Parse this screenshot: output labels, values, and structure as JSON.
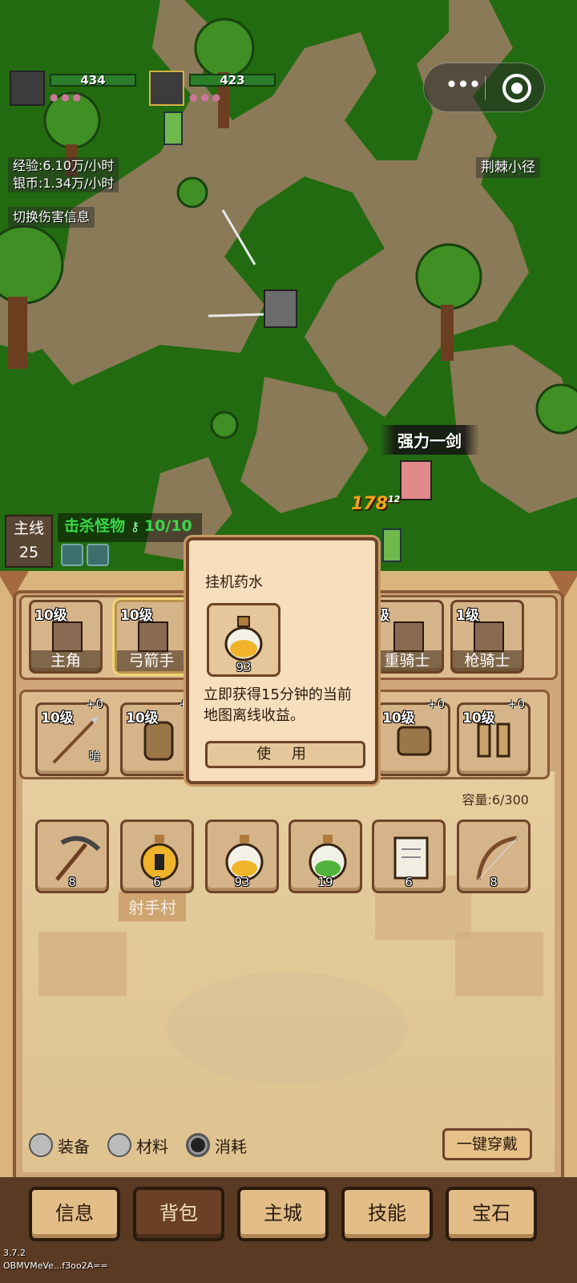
{
  "hud": {
    "player1_hp": "434",
    "player2_hp": "423",
    "exp_rate": "经验:6.10万/小时",
    "silver_rate": "银币:1.34万/小时",
    "toggle_damage": "切换伤害信息",
    "map_name": "荆棘小径",
    "skill_name": "强力一剑",
    "damage_value": "178",
    "damage_sub": "12"
  },
  "capsule": {
    "more_label": "•••"
  },
  "quest": {
    "main_label": "主线",
    "main_number": "25",
    "task_text": "击杀怪物",
    "task_progress": "10/10"
  },
  "heroes": [
    {
      "level": "10级",
      "name": "主角"
    },
    {
      "level": "10级",
      "name": "弓箭手"
    },
    {
      "level": "级",
      "name": "重骑士"
    },
    {
      "level": "1级",
      "name": "枪骑士"
    }
  ],
  "equipment": [
    {
      "level": "10级",
      "plus": "+0",
      "tag": "暗",
      "icon": "spear-icon"
    },
    {
      "level": "10级",
      "plus": "+",
      "tag": "",
      "icon": "helmet-icon"
    },
    {
      "level": "10级",
      "plus": "+0",
      "tag": "",
      "icon": "gloves-icon"
    },
    {
      "level": "10级",
      "plus": "+0",
      "tag": "",
      "icon": "boots-icon"
    }
  ],
  "capacity": "容量:6/300",
  "inventory": [
    {
      "count": "8",
      "icon": "pickaxe-icon"
    },
    {
      "count": "6",
      "icon": "potion-dark-icon"
    },
    {
      "count": "93",
      "icon": "potion-gold-icon"
    },
    {
      "count": "19",
      "icon": "potion-green-icon"
    },
    {
      "count": "6",
      "icon": "scroll-icon"
    },
    {
      "count": "8",
      "icon": "bow-icon"
    }
  ],
  "village_sign": "射手村",
  "filters": {
    "equip": "装备",
    "material": "材料",
    "consume": "消耗",
    "active": "consume"
  },
  "wear_all_label": "一键穿戴",
  "popup": {
    "title": "挂机药水",
    "count": "93",
    "desc": "立即获得15分钟的当前地图离线收益。",
    "use_label": "使 用"
  },
  "nav": [
    {
      "label": "信息"
    },
    {
      "label": "背包"
    },
    {
      "label": "主城"
    },
    {
      "label": "技能"
    },
    {
      "label": "宝石"
    }
  ],
  "version": {
    "line1": "3.7.2",
    "line2": "OBMVMeVe...f3oo2A=="
  },
  "colors": {
    "grass": "#236b10",
    "path": "#8a7a57",
    "panel": "#d9b47d",
    "nav_bg": "#5a3a22",
    "task_green": "#39d84a",
    "damage": "#f3a21b"
  }
}
